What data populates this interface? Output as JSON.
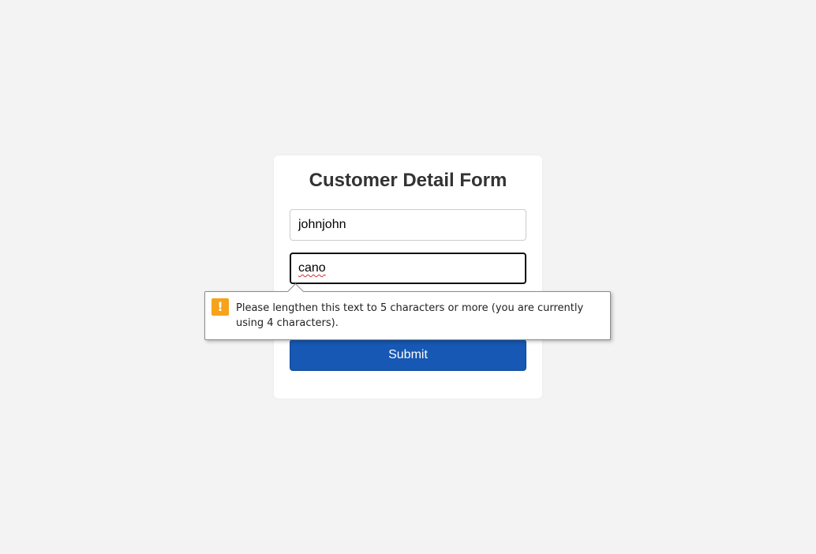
{
  "form": {
    "title": "Customer Detail Form",
    "username_value": "johnjohn",
    "focused_value": "cano",
    "submit_label": "Submit"
  },
  "validation_tooltip": {
    "icon": "warning-icon",
    "message": "Please lengthen this text to 5 characters or more (you are currently using 4 characters)."
  },
  "colors": {
    "background": "#f3f3f3",
    "card": "#ffffff",
    "submit_button": "#1658b3",
    "warning_icon": "#f7a21b"
  }
}
